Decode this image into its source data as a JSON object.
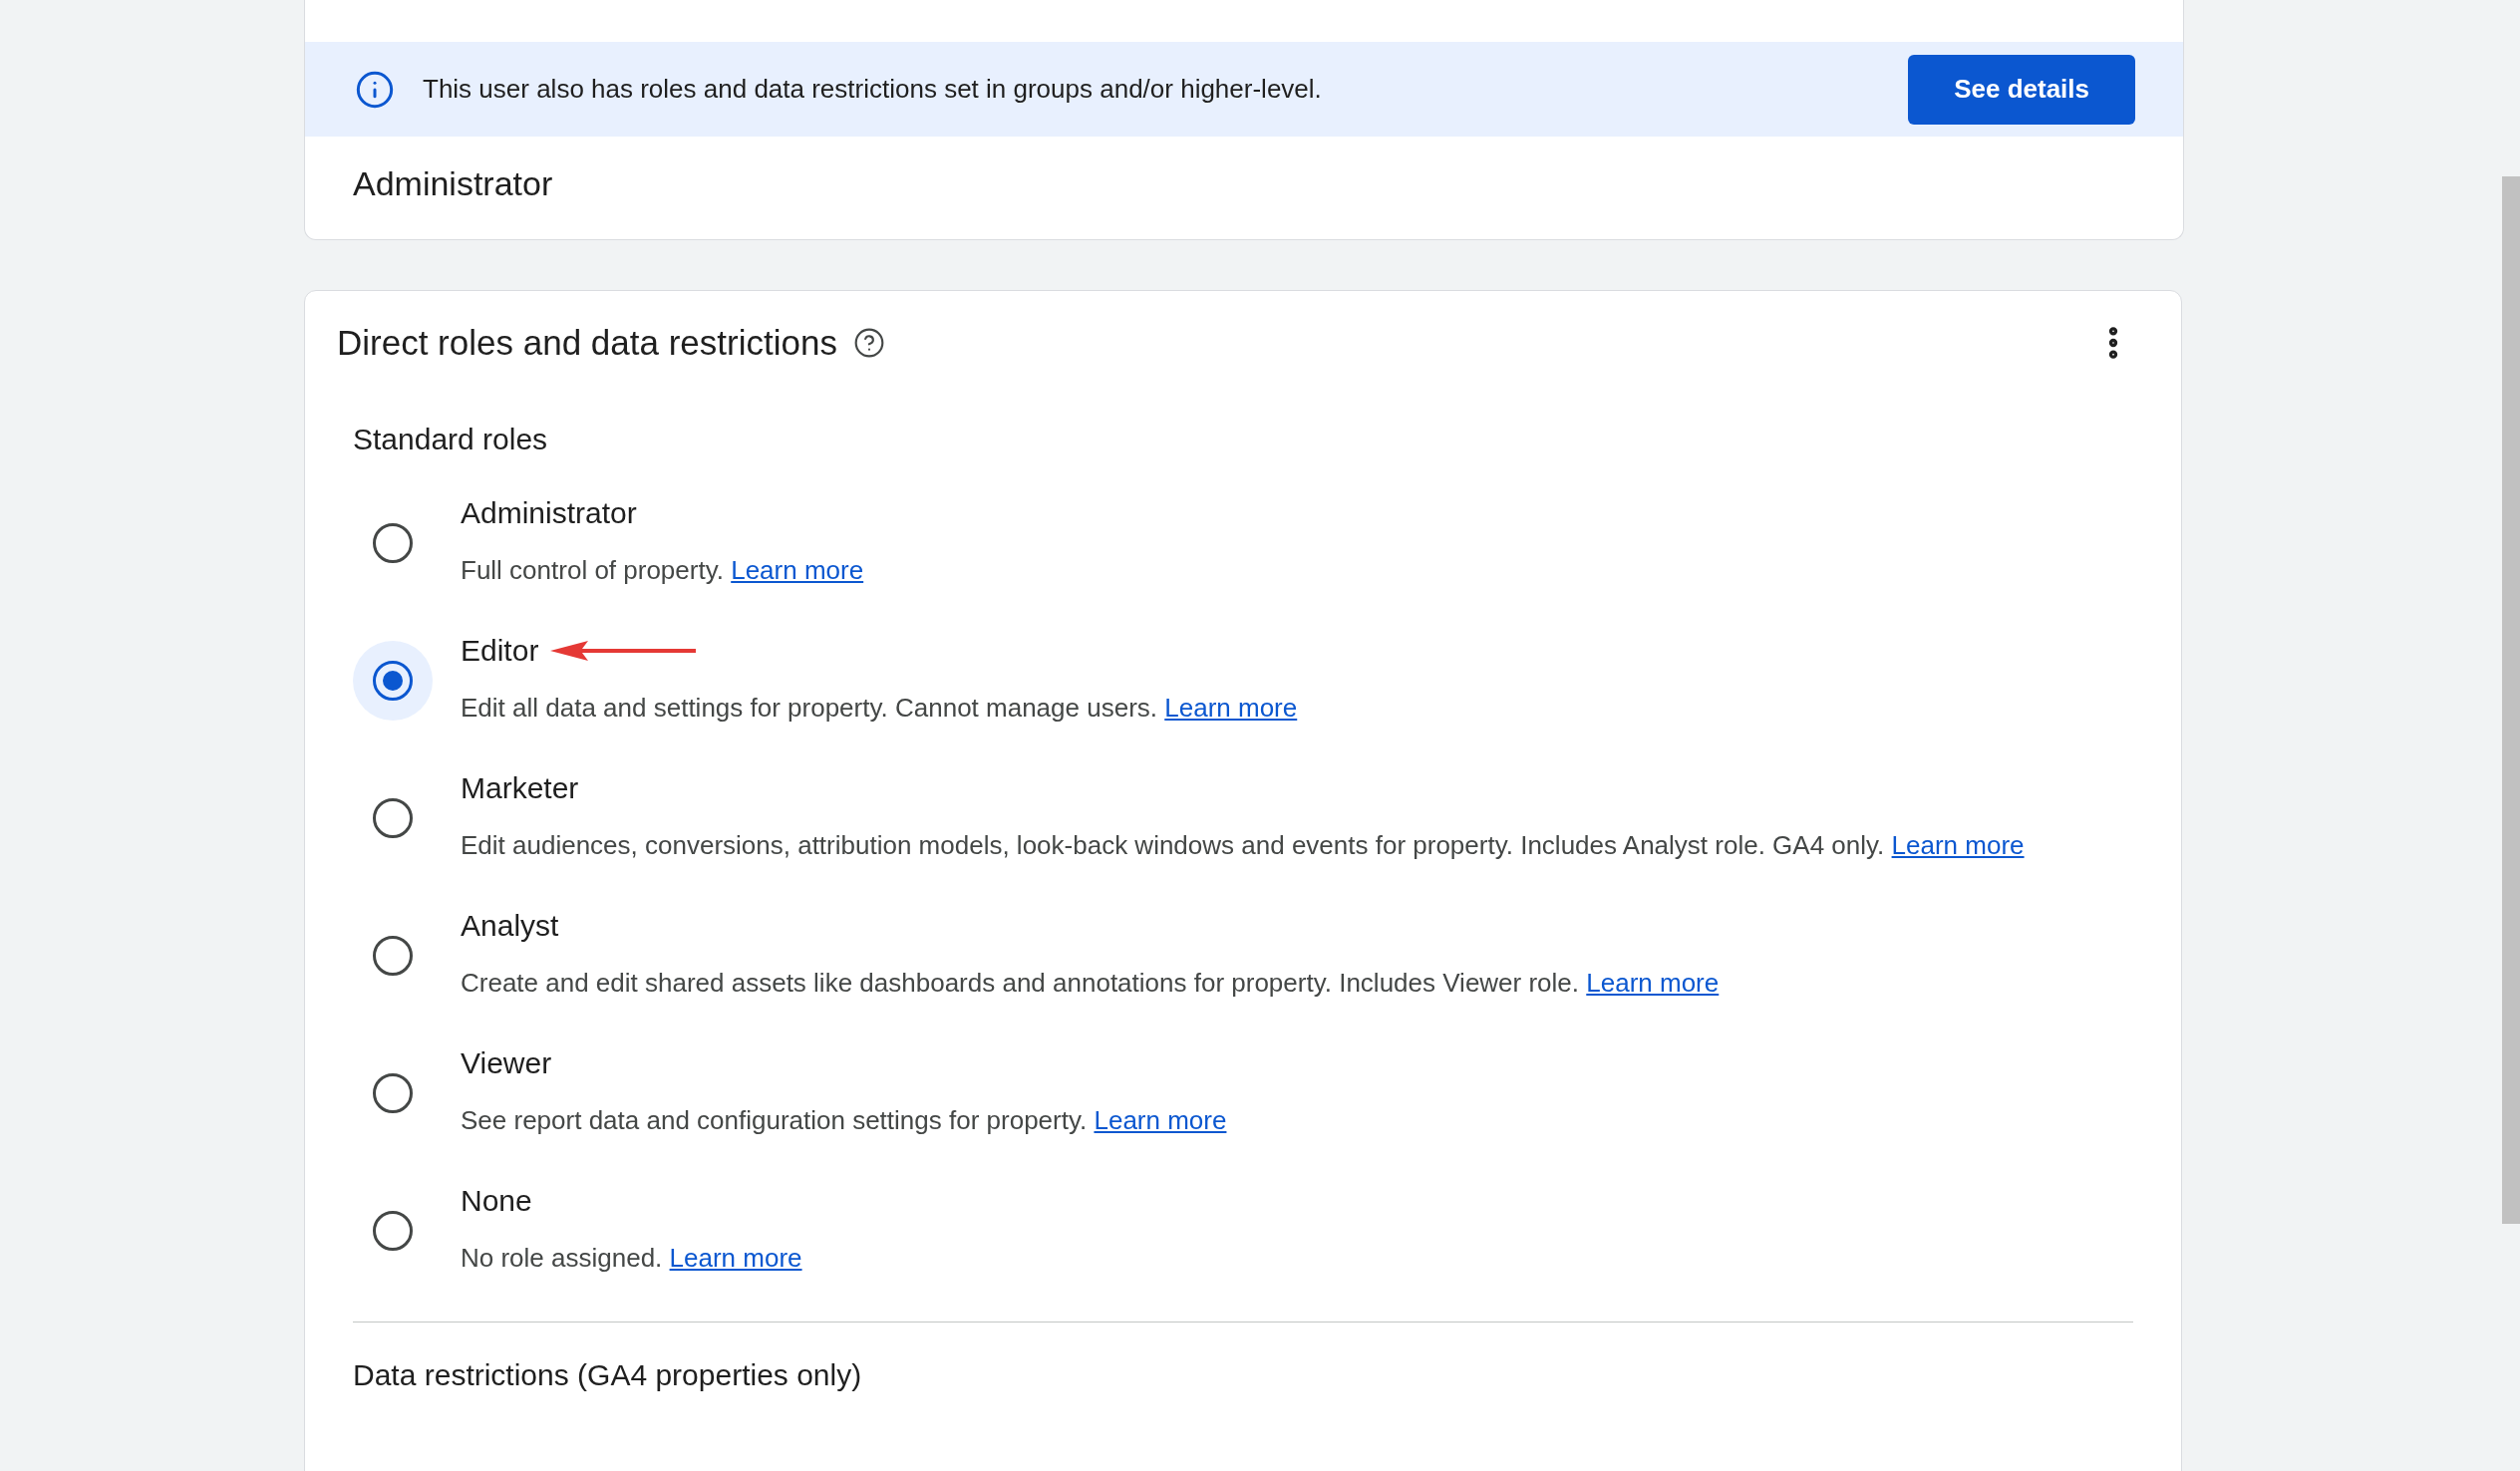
{
  "notice": {
    "text": "This user also has roles and data restrictions set in groups and/or higher-level.",
    "button": "See details"
  },
  "current_role": "Administrator",
  "direct_roles": {
    "title": "Direct roles and data restrictions",
    "section": "Standard roles",
    "roles": [
      {
        "name": "Administrator",
        "description": "Full control of property.",
        "link": "Learn more",
        "selected": false
      },
      {
        "name": "Editor",
        "description": "Edit all data and settings for property. Cannot manage users.",
        "link": "Learn more",
        "selected": true
      },
      {
        "name": "Marketer",
        "description": "Edit audiences, conversions, attribution models, look-back windows and events for property. Includes Analyst role. GA4 only.",
        "link": "Learn more",
        "selected": false
      },
      {
        "name": "Analyst",
        "description": "Create and edit shared assets like dashboards and annotations for property. Includes Viewer role.",
        "link": "Learn more",
        "selected": false
      },
      {
        "name": "Viewer",
        "description": "See report data and configuration settings for property.",
        "link": "Learn more",
        "selected": false
      },
      {
        "name": "None",
        "description": "No role assigned.",
        "link": "Learn more",
        "selected": false
      }
    ],
    "next_section": "Data restrictions (GA4 properties only)"
  }
}
